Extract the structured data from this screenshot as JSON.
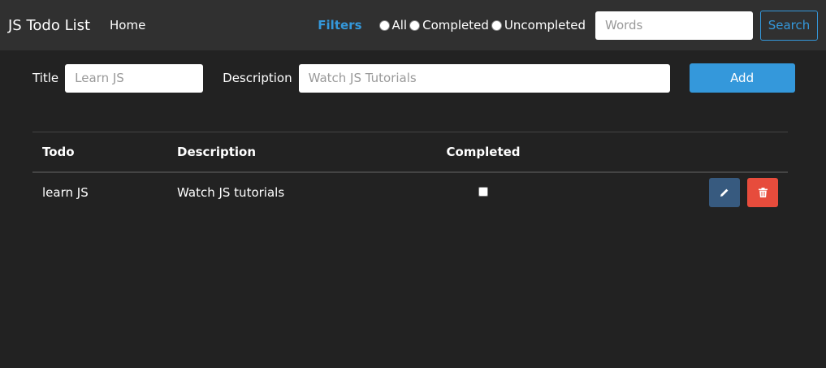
{
  "navbar": {
    "brand": "JS Todo List",
    "home_link": "Home",
    "filters_label": "Filters",
    "filter_options": [
      "All",
      "Completed",
      "Uncompleted"
    ],
    "search_placeholder": "Words",
    "search_button": "Search"
  },
  "add_form": {
    "title_label": "Title",
    "title_placeholder": "Learn JS",
    "description_label": "Description",
    "description_placeholder": "Watch JS Tutorials",
    "add_button": "Add"
  },
  "table": {
    "headers": [
      "Todo",
      "Description",
      "Completed",
      ""
    ],
    "rows": [
      {
        "todo": "learn JS",
        "description": "Watch JS tutorials",
        "completed": false
      }
    ]
  },
  "colors": {
    "accent": "#3498db",
    "edit": "#375a7f",
    "delete": "#e74c3c",
    "background": "#222222",
    "navbar": "#303030"
  },
  "icons": {
    "edit": "pencil-icon",
    "delete": "trash-icon"
  }
}
